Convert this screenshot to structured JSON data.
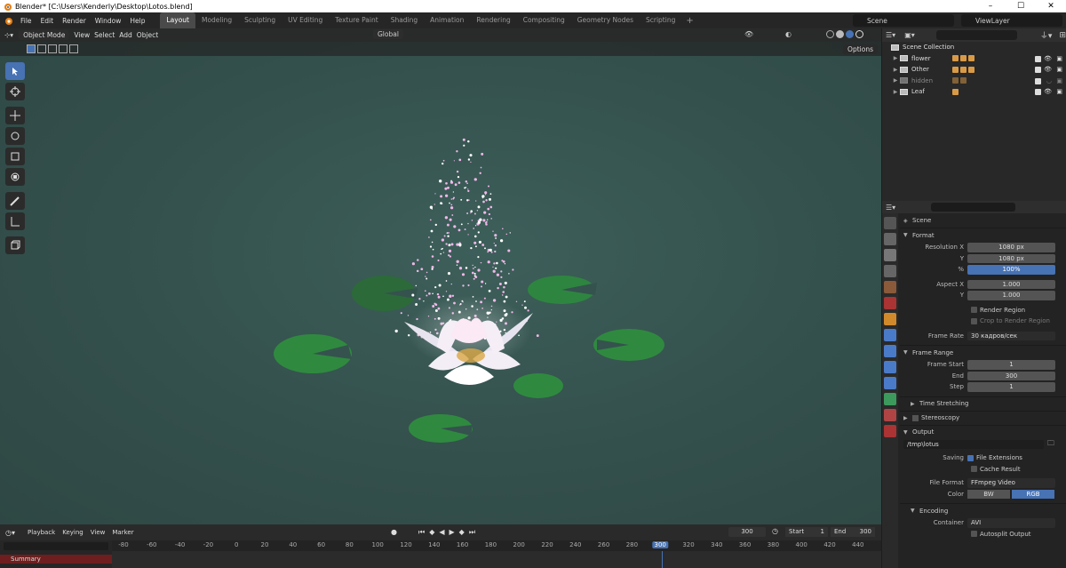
{
  "window": {
    "title": "Blender* [C:\\Users\\Kenderly\\Desktop\\Lotos.blend]",
    "controls": [
      "–",
      "☐",
      "✕"
    ]
  },
  "topbar": {
    "menus": [
      "File",
      "Edit",
      "Render",
      "Window",
      "Help"
    ],
    "workspaces": [
      "Layout",
      "Modeling",
      "Sculpting",
      "UV Editing",
      "Texture Paint",
      "Shading",
      "Animation",
      "Rendering",
      "Compositing",
      "Geometry Nodes",
      "Scripting"
    ],
    "active_workspace": "Layout",
    "add_workspace": "+",
    "scene": "Scene",
    "view_layer": "ViewLayer"
  },
  "viewport": {
    "mode": "Object Mode",
    "menus": [
      "View",
      "Select",
      "Add",
      "Object"
    ],
    "orientation": "Global",
    "options": "Options"
  },
  "outliner": {
    "root": "Scene Collection",
    "collections": [
      {
        "name": "flower",
        "visible": true
      },
      {
        "name": "Other",
        "visible": true
      },
      {
        "name": "hidden",
        "visible": false
      },
      {
        "name": "Leaf",
        "visible": true
      }
    ]
  },
  "properties": {
    "context": "Scene",
    "format": {
      "label": "Format",
      "resolution_x_label": "Resolution X",
      "resolution_x": "1080 px",
      "resolution_y_label": "Y",
      "resolution_y": "1080 px",
      "percent_label": "%",
      "percent": "100%",
      "aspect_x_label": "Aspect X",
      "aspect_x": "1.000",
      "aspect_y_label": "Y",
      "aspect_y": "1.000",
      "render_region": "Render Region",
      "crop_region": "Crop to Render Region",
      "frame_rate_label": "Frame Rate",
      "frame_rate": "30 кадров/сек"
    },
    "frame_range": {
      "label": "Frame Range",
      "start_label": "Frame Start",
      "start": "1",
      "end_label": "End",
      "end": "300",
      "step_label": "Step",
      "step": "1"
    },
    "time_stretching": "Time Stretching",
    "stereoscopy": "Stereoscopy",
    "output": {
      "label": "Output",
      "path": "/tmp\\lotus",
      "saving_label": "Saving",
      "file_extensions": "File Extensions",
      "cache_result": "Cache Result",
      "file_format_label": "File Format",
      "file_format": "FFmpeg Video",
      "color_label": "Color",
      "color_bw": "BW",
      "color_rgb": "RGB"
    },
    "encoding": {
      "label": "Encoding",
      "container_label": "Container",
      "container": "AVI",
      "autosplit": "Autosplit Output"
    }
  },
  "timeline": {
    "menus": [
      "Playback",
      "Keying",
      "View",
      "Marker"
    ],
    "current_frame": "300",
    "start_label": "Start",
    "start": "1",
    "end_label": "End",
    "end": "300",
    "ruler": [
      "-80",
      "-60",
      "-40",
      "-20",
      "0",
      "20",
      "40",
      "60",
      "80",
      "100",
      "120",
      "140",
      "160",
      "180",
      "200",
      "220",
      "240",
      "260",
      "280",
      "300",
      "320",
      "340",
      "360",
      "380",
      "400",
      "420",
      "440"
    ],
    "summary": "Summary"
  },
  "colors": {
    "accent": "#4772b3",
    "water": "#35524e",
    "leaf": "#2f8a3f",
    "petal": "#f3eef5",
    "spark": "#f1b6e8"
  }
}
